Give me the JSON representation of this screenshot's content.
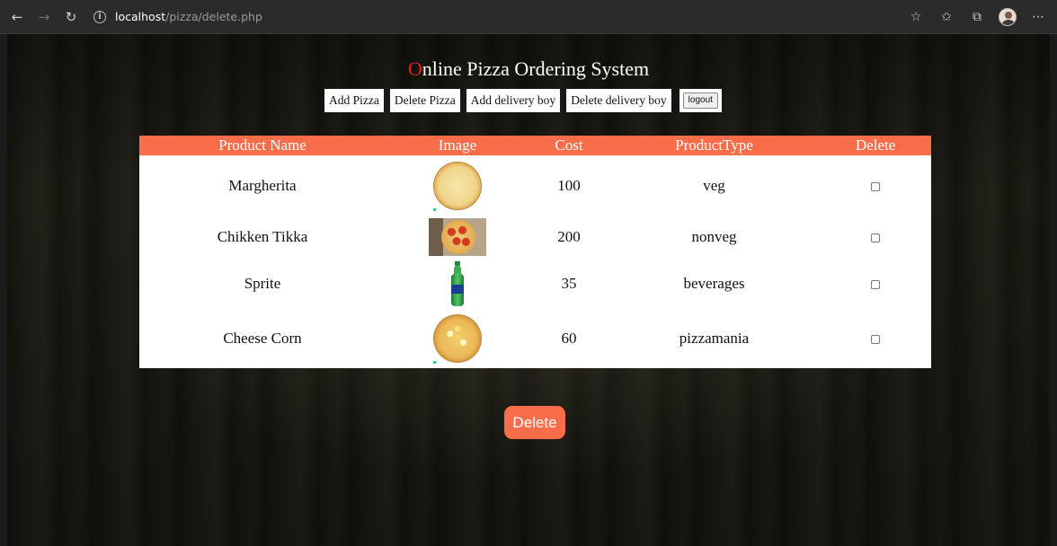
{
  "browser": {
    "url_host": "localhost",
    "url_path": "/pizza/delete.php"
  },
  "header": {
    "title_first": "O",
    "title_rest": "nline Pizza Ordering System"
  },
  "menu": {
    "add_pizza": "Add Pizza",
    "delete_pizza": "Delete Pizza",
    "add_delivery_boy": "Add delivery boy",
    "delete_delivery_boy": "Delete delivery boy",
    "logout": "logout"
  },
  "table": {
    "headers": [
      "Product Name",
      "Image",
      "Cost",
      "ProductType",
      "Delete"
    ],
    "rows": [
      {
        "name": "Margherita",
        "image": "pizza-plain-icon",
        "cost": "100",
        "type": "veg"
      },
      {
        "name": "Chikken Tikka",
        "image": "pizza-pepperoni-icon",
        "cost": "200",
        "type": "nonveg"
      },
      {
        "name": "Sprite",
        "image": "bottle-icon",
        "cost": "35",
        "type": "beverages"
      },
      {
        "name": "Cheese Corn",
        "image": "pizza-cheese-icon",
        "cost": "60",
        "type": "pizzamania"
      }
    ]
  },
  "actions": {
    "delete": "Delete"
  },
  "colors": {
    "accent": "#fa6d4b",
    "title_first_letter": "#e61e1e"
  }
}
